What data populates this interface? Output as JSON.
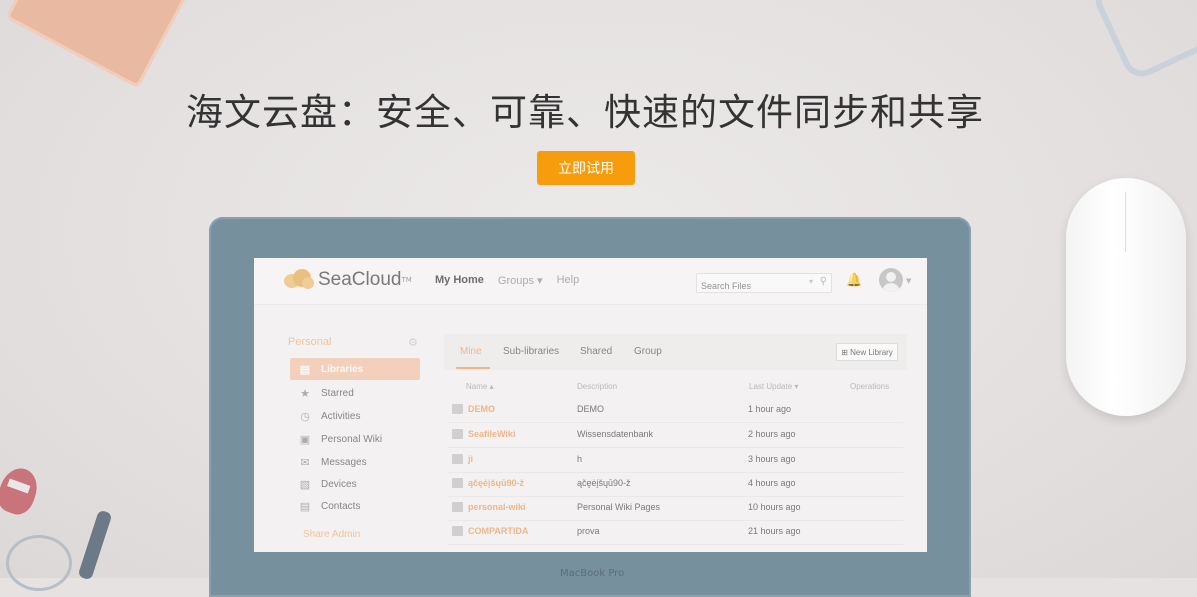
{
  "hero": {
    "headline": "海文云盘：安全、可靠、快速的文件同步和共享",
    "cta_label": "立即试用"
  },
  "laptop": {
    "brand": "MacBook Pro"
  },
  "app": {
    "logo_text": "SeaCloud",
    "logo_tm": "TM",
    "nav": {
      "home": "My Home",
      "groups": "Groups ▾",
      "help": "Help"
    },
    "search": {
      "placeholder": "Search Files",
      "caret": "▾",
      "icon": "search-icon"
    },
    "header_icons": [
      "bell-icon",
      "avatar"
    ],
    "sidebar": {
      "section_title": "Personal",
      "items": [
        {
          "label": "Libraries",
          "icon": "library-icon"
        },
        {
          "label": "Starred",
          "icon": "star-icon"
        },
        {
          "label": "Activities",
          "icon": "clock-icon"
        },
        {
          "label": "Personal Wiki",
          "icon": "wiki-icon"
        },
        {
          "label": "Messages",
          "icon": "message-icon"
        },
        {
          "label": "Devices",
          "icon": "monitor-icon"
        },
        {
          "label": "Contacts",
          "icon": "contacts-icon"
        }
      ],
      "admin_title": "Share Admin"
    },
    "tabs": [
      "Mine",
      "Sub-libraries",
      "Shared",
      "Group"
    ],
    "new_library": "New Library",
    "columns": {
      "name": "Name ▴",
      "description": "Description",
      "last_update": "Last Update ▾",
      "operations": "Operations"
    },
    "rows": [
      {
        "name": "DEMO",
        "description": "DEMO",
        "last_update": "1 hour ago"
      },
      {
        "name": "SeafileWiki",
        "description": "Wissensdatenbank",
        "last_update": "2 hours ago"
      },
      {
        "name": "ji",
        "description": "h",
        "last_update": "3 hours ago"
      },
      {
        "name": "ąčęėįšųū90-ž",
        "description": "ąčęėįšųū90-ž",
        "last_update": "4 hours ago"
      },
      {
        "name": "personal-wiki",
        "description": "Personal Wiki Pages",
        "last_update": "10 hours ago"
      },
      {
        "name": "COMPARTIDA",
        "description": "prova",
        "last_update": "21 hours ago"
      }
    ]
  }
}
